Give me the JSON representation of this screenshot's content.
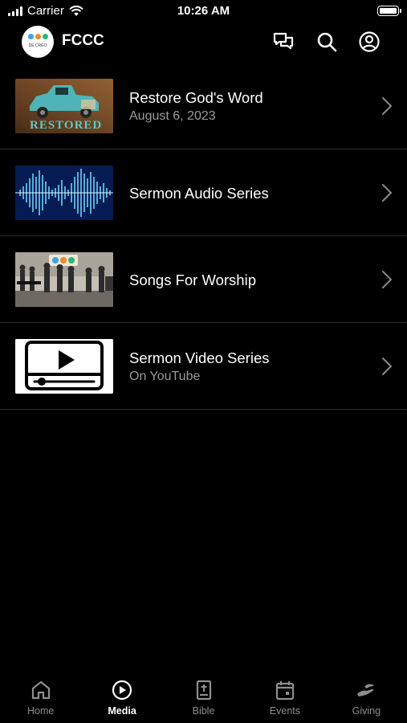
{
  "status_bar": {
    "carrier": "Carrier",
    "time": "10:26 AM"
  },
  "header": {
    "title": "FCCC",
    "logo_text": "DE CREO",
    "icons": [
      "chat-icon",
      "search-icon",
      "profile-icon"
    ]
  },
  "media_items": [
    {
      "title": "Restore God's Word",
      "subtitle": "August 6, 2023",
      "thumb_text": "RESTORED"
    },
    {
      "title": "Sermon Audio Series",
      "subtitle": ""
    },
    {
      "title": "Songs For Worship",
      "subtitle": ""
    },
    {
      "title": "Sermon Video Series",
      "subtitle": "On YouTube"
    }
  ],
  "tabs": [
    {
      "label": "Home",
      "icon": "home-icon",
      "active": false
    },
    {
      "label": "Media",
      "icon": "play-circle-icon",
      "active": true
    },
    {
      "label": "Bible",
      "icon": "bible-icon",
      "active": false
    },
    {
      "label": "Events",
      "icon": "calendar-icon",
      "active": false
    },
    {
      "label": "Giving",
      "icon": "giving-hand-icon",
      "active": false
    }
  ],
  "colors": {
    "background": "#000000",
    "text": "#ffffff",
    "muted": "#9a9a9a",
    "tab_inactive": "#8e8e8e",
    "divider": "#2a2a2a"
  }
}
